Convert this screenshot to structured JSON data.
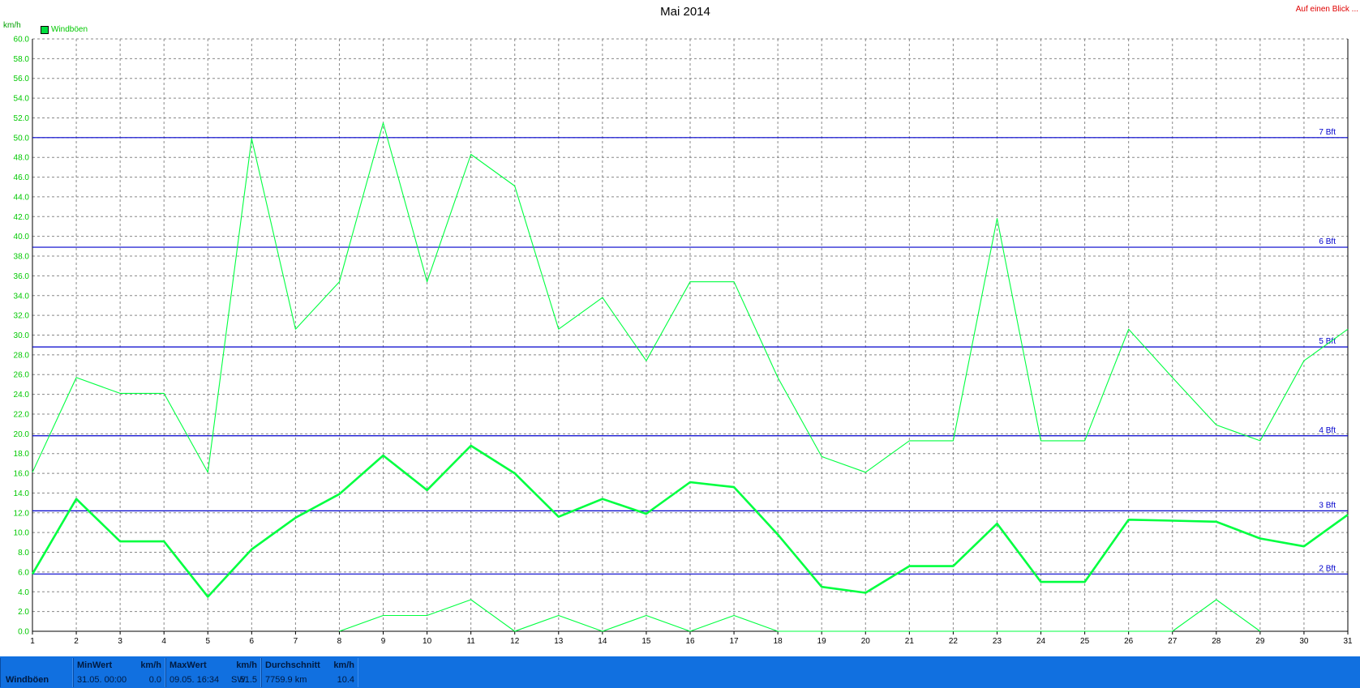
{
  "header": {
    "title": "Mai 2014",
    "link": "Auf einen Blick ..."
  },
  "colors": {
    "line": "#00ff40",
    "bft": "#0000cc",
    "grid": "#888888",
    "label": "#00c800"
  },
  "chart_data": {
    "type": "line",
    "title": "Mai 2014",
    "ylabel": "km/h",
    "xlabel": "",
    "xlim": [
      1,
      31
    ],
    "ylim": [
      0,
      60
    ],
    "grid": true,
    "legend": {
      "entries": [
        "Windböen"
      ],
      "placement": "top-left"
    },
    "x_ticks": [
      "1",
      "2",
      "3",
      "4",
      "5",
      "6",
      "7",
      "8",
      "9",
      "10",
      "11",
      "12",
      "13",
      "14",
      "15",
      "16",
      "17",
      "18",
      "19",
      "20",
      "21",
      "22",
      "23",
      "24",
      "25",
      "26",
      "27",
      "28",
      "29",
      "30",
      "31"
    ],
    "y_ticks": [
      "0.0",
      "2.0",
      "4.0",
      "6.0",
      "8.0",
      "10.0",
      "12.0",
      "14.0",
      "16.0",
      "18.0",
      "20.0",
      "22.0",
      "24.0",
      "26.0",
      "28.0",
      "30.0",
      "32.0",
      "34.0",
      "36.0",
      "38.0",
      "40.0",
      "42.0",
      "44.0",
      "46.0",
      "48.0",
      "50.0",
      "52.0",
      "54.0",
      "56.0",
      "58.0",
      "60.0"
    ],
    "thresholds": [
      {
        "label": "2 Bft",
        "value": 5.8
      },
      {
        "label": "3 Bft",
        "value": 12.2
      },
      {
        "label": "4 Bft",
        "value": 19.8
      },
      {
        "label": "5 Bft",
        "value": 28.8
      },
      {
        "label": "6 Bft",
        "value": 38.9
      },
      {
        "label": "7 Bft",
        "value": 50.0
      }
    ],
    "series": [
      {
        "name": "Windböen",
        "role": "max",
        "x": [
          1,
          2,
          3,
          4,
          5,
          6,
          7,
          8,
          9,
          10,
          11,
          12,
          13,
          14,
          15,
          16,
          17,
          18,
          19,
          20,
          21,
          22,
          23,
          24,
          25,
          26,
          27,
          28,
          29,
          30,
          31
        ],
        "values": [
          16.1,
          25.7,
          24.1,
          24.1,
          16.1,
          49.9,
          30.6,
          35.4,
          51.5,
          35.4,
          48.3,
          45.1,
          30.6,
          33.8,
          27.4,
          35.4,
          35.4,
          25.7,
          17.7,
          16.1,
          19.3,
          19.3,
          41.8,
          19.3,
          19.3,
          30.6,
          25.7,
          20.9,
          19.3,
          27.4,
          30.6
        ]
      },
      {
        "name": "Windböen",
        "role": "avg",
        "x": [
          1,
          2,
          3,
          4,
          5,
          6,
          7,
          8,
          9,
          10,
          11,
          12,
          13,
          14,
          15,
          16,
          17,
          18,
          19,
          20,
          21,
          22,
          23,
          24,
          25,
          26,
          27,
          28,
          29,
          30,
          31
        ],
        "values": [
          5.8,
          13.4,
          9.1,
          9.1,
          3.5,
          8.3,
          11.5,
          13.9,
          17.8,
          14.3,
          18.8,
          16.0,
          11.6,
          13.4,
          11.9,
          15.1,
          14.6,
          9.8,
          4.5,
          3.9,
          6.6,
          6.6,
          10.9,
          5.0,
          5.0,
          11.3,
          11.2,
          11.1,
          9.4,
          8.6,
          11.8
        ]
      },
      {
        "name": "Windböen",
        "role": "min",
        "x": [
          8,
          9,
          10,
          11,
          12,
          13,
          14,
          15,
          16,
          17,
          18,
          27,
          28,
          29
        ],
        "values": [
          0.0,
          1.6,
          1.6,
          3.2,
          0.0,
          1.6,
          0.0,
          1.6,
          0.0,
          1.6,
          0.0,
          0.0,
          3.2,
          0.0
        ]
      }
    ]
  },
  "footer": {
    "name": "Windböen",
    "min": {
      "head": "MinWert",
      "unit": "km/h",
      "when": "31.05.  00:00",
      "value": "0.0"
    },
    "max": {
      "head": "MaxWert",
      "unit": "km/h",
      "when": "09.05.  16:34",
      "dir": "SW",
      "value": "51.5"
    },
    "avg": {
      "head": "Durchschnitt",
      "unit": "km/h",
      "dist": "7759.9 km",
      "value": "10.4"
    }
  }
}
